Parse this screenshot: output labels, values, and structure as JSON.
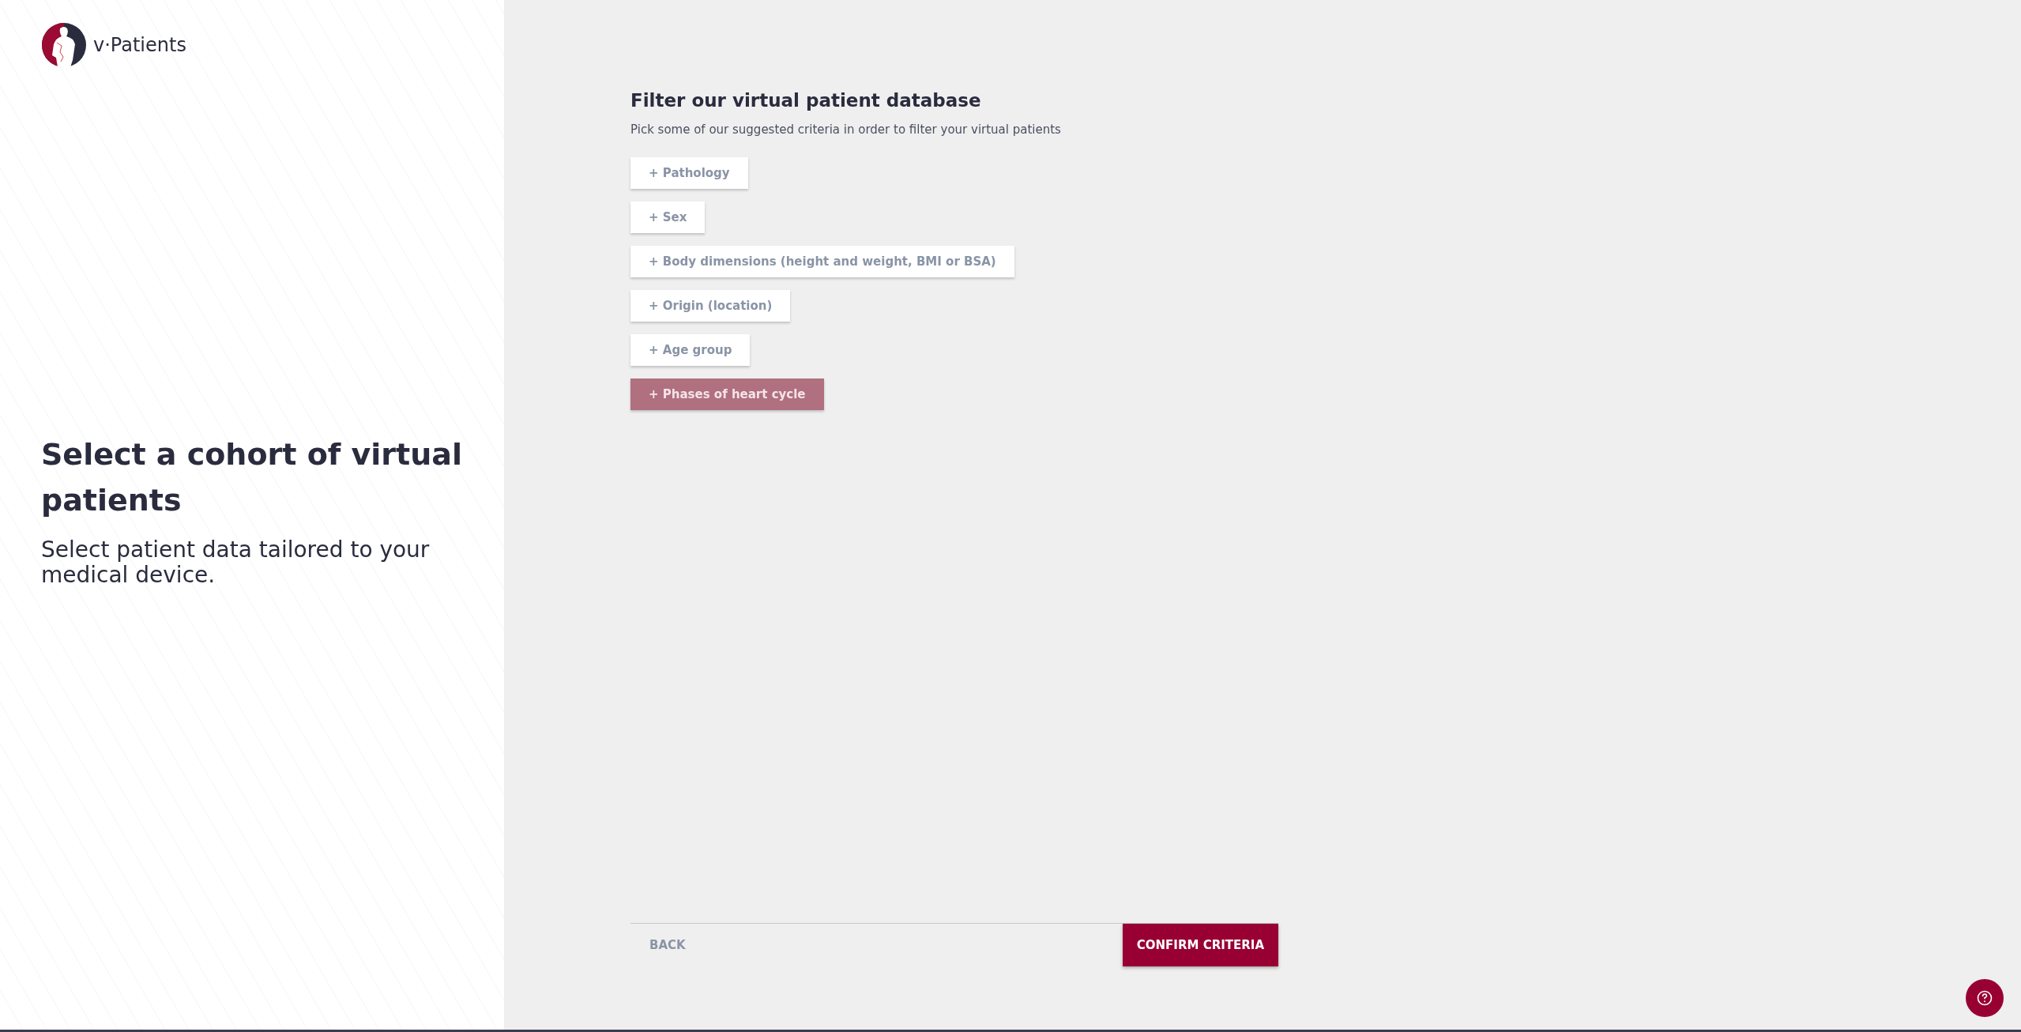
{
  "brand": {
    "name": "v·Patients"
  },
  "intro": {
    "title": "Select a cohort of virtual patients",
    "subtitle": "Select patient data tailored to your medical device."
  },
  "filter": {
    "title": "Filter our virtual patient database",
    "description": "Pick some of our suggested criteria in order to filter your virtual patients",
    "criteria": [
      {
        "label": "+ Pathology",
        "selected": false
      },
      {
        "label": "+ Sex",
        "selected": false
      },
      {
        "label": "+ Body dimensions (height and weight, BMI or BSA)",
        "selected": false
      },
      {
        "label": "+ Origin (location)",
        "selected": false
      },
      {
        "label": "+ Age group",
        "selected": false
      },
      {
        "label": "+ Phases of heart cycle",
        "selected": true
      }
    ]
  },
  "footer": {
    "back": "BACK",
    "confirm": "CONFIRM CRITERIA"
  }
}
